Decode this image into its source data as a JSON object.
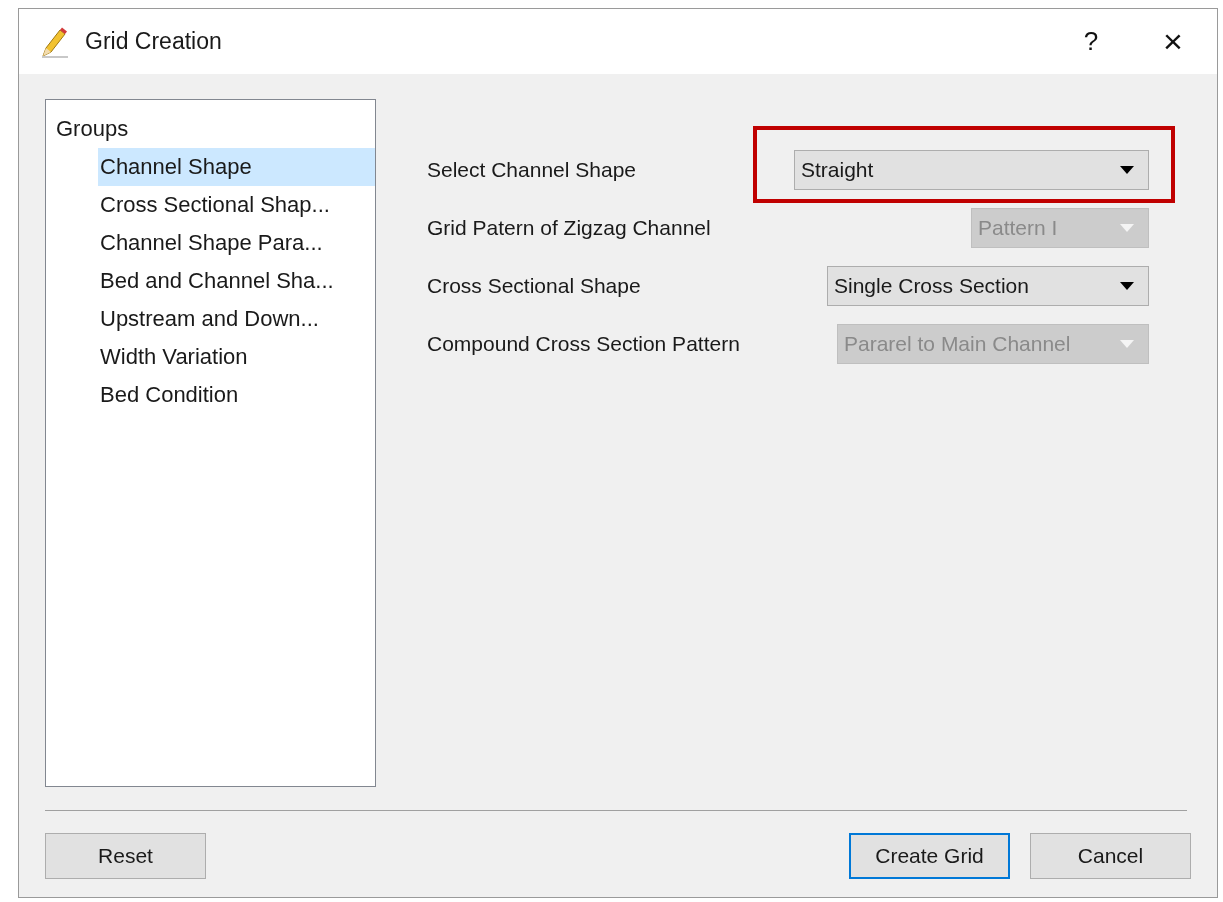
{
  "window": {
    "title": "Grid Creation",
    "help_button": "?",
    "close_button": "×"
  },
  "tree": {
    "label": "Groups",
    "children": [
      {
        "label": "Channel Shape",
        "selected": true
      },
      {
        "label": "Cross Sectional Shap...",
        "selected": false
      },
      {
        "label": "Channel Shape Para...",
        "selected": false
      },
      {
        "label": "Bed and Channel Sha...",
        "selected": false
      },
      {
        "label": "Upstream and Down...",
        "selected": false
      },
      {
        "label": "Width Variation",
        "selected": false
      },
      {
        "label": "Bed Condition",
        "selected": false
      }
    ]
  },
  "settings": [
    {
      "label": "Select Channel Shape",
      "value": "Straight",
      "disabled": false,
      "highlighted": true
    },
    {
      "label": "Grid Patern of Zigzag Channel",
      "value": "Pattern I",
      "disabled": true,
      "highlighted": false
    },
    {
      "label": "Cross Sectional Shape",
      "value": "Single Cross Section",
      "disabled": false,
      "highlighted": false
    },
    {
      "label": "Compound Cross Section Pattern",
      "value": "Pararel to Main Channel",
      "disabled": true,
      "highlighted": false
    }
  ],
  "buttons": [
    {
      "label": "Reset",
      "kind": "left",
      "default": false
    },
    {
      "label": "Create Grid",
      "kind": "right",
      "default": true
    },
    {
      "label": "Cancel",
      "kind": "right",
      "default": false
    }
  ]
}
